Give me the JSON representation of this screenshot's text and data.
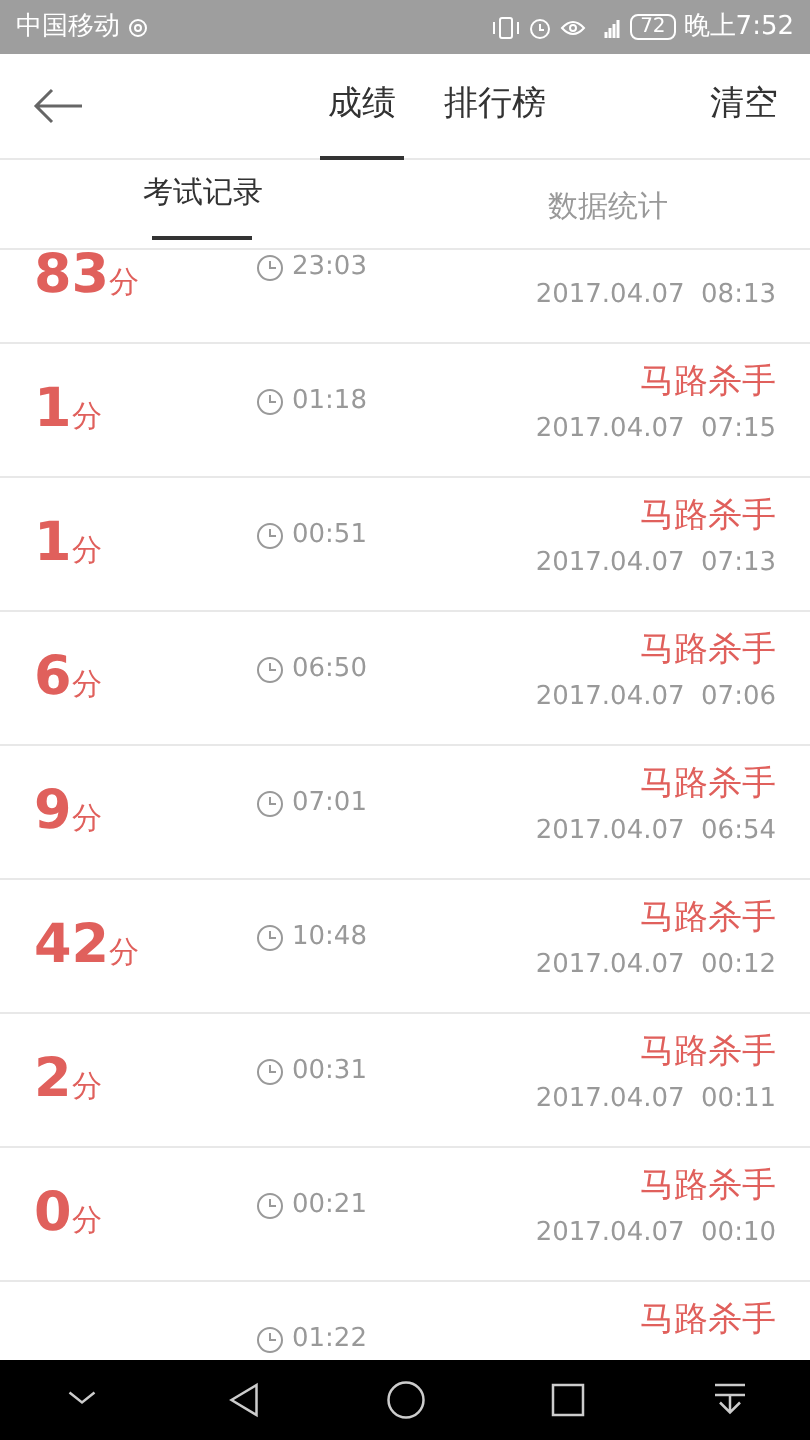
{
  "status_bar": {
    "carrier": "中国移动",
    "battery": "72",
    "time": "晚上7:52"
  },
  "header": {
    "tabs": [
      {
        "label": "成绩",
        "selected": true
      },
      {
        "label": "排行榜",
        "selected": false
      }
    ],
    "action": "清空"
  },
  "subtabs": [
    {
      "label": "考试记录",
      "selected": true
    },
    {
      "label": "数据统计",
      "selected": false
    }
  ],
  "records": [
    {
      "score": "83",
      "unit": "分",
      "duration": "23:03",
      "date": "2017.04.07  08:13"
    },
    {
      "score": "1",
      "unit": "分",
      "duration": "01:18",
      "title": "马路杀手",
      "date": "2017.04.07  07:15"
    },
    {
      "score": "1",
      "unit": "分",
      "duration": "00:51",
      "title": "马路杀手",
      "date": "2017.04.07  07:13"
    },
    {
      "score": "6",
      "unit": "分",
      "duration": "06:50",
      "title": "马路杀手",
      "date": "2017.04.07  07:06"
    },
    {
      "score": "9",
      "unit": "分",
      "duration": "07:01",
      "title": "马路杀手",
      "date": "2017.04.07  06:54"
    },
    {
      "score": "42",
      "unit": "分",
      "duration": "10:48",
      "title": "马路杀手",
      "date": "2017.04.07  00:12"
    },
    {
      "score": "2",
      "unit": "分",
      "duration": "00:31",
      "title": "马路杀手",
      "date": "2017.04.07  00:11"
    },
    {
      "score": "0",
      "unit": "分",
      "duration": "00:21",
      "title": "马路杀手",
      "date": "2017.04.07  00:10"
    },
    {
      "duration": "01:22",
      "title": "马路杀手"
    }
  ]
}
